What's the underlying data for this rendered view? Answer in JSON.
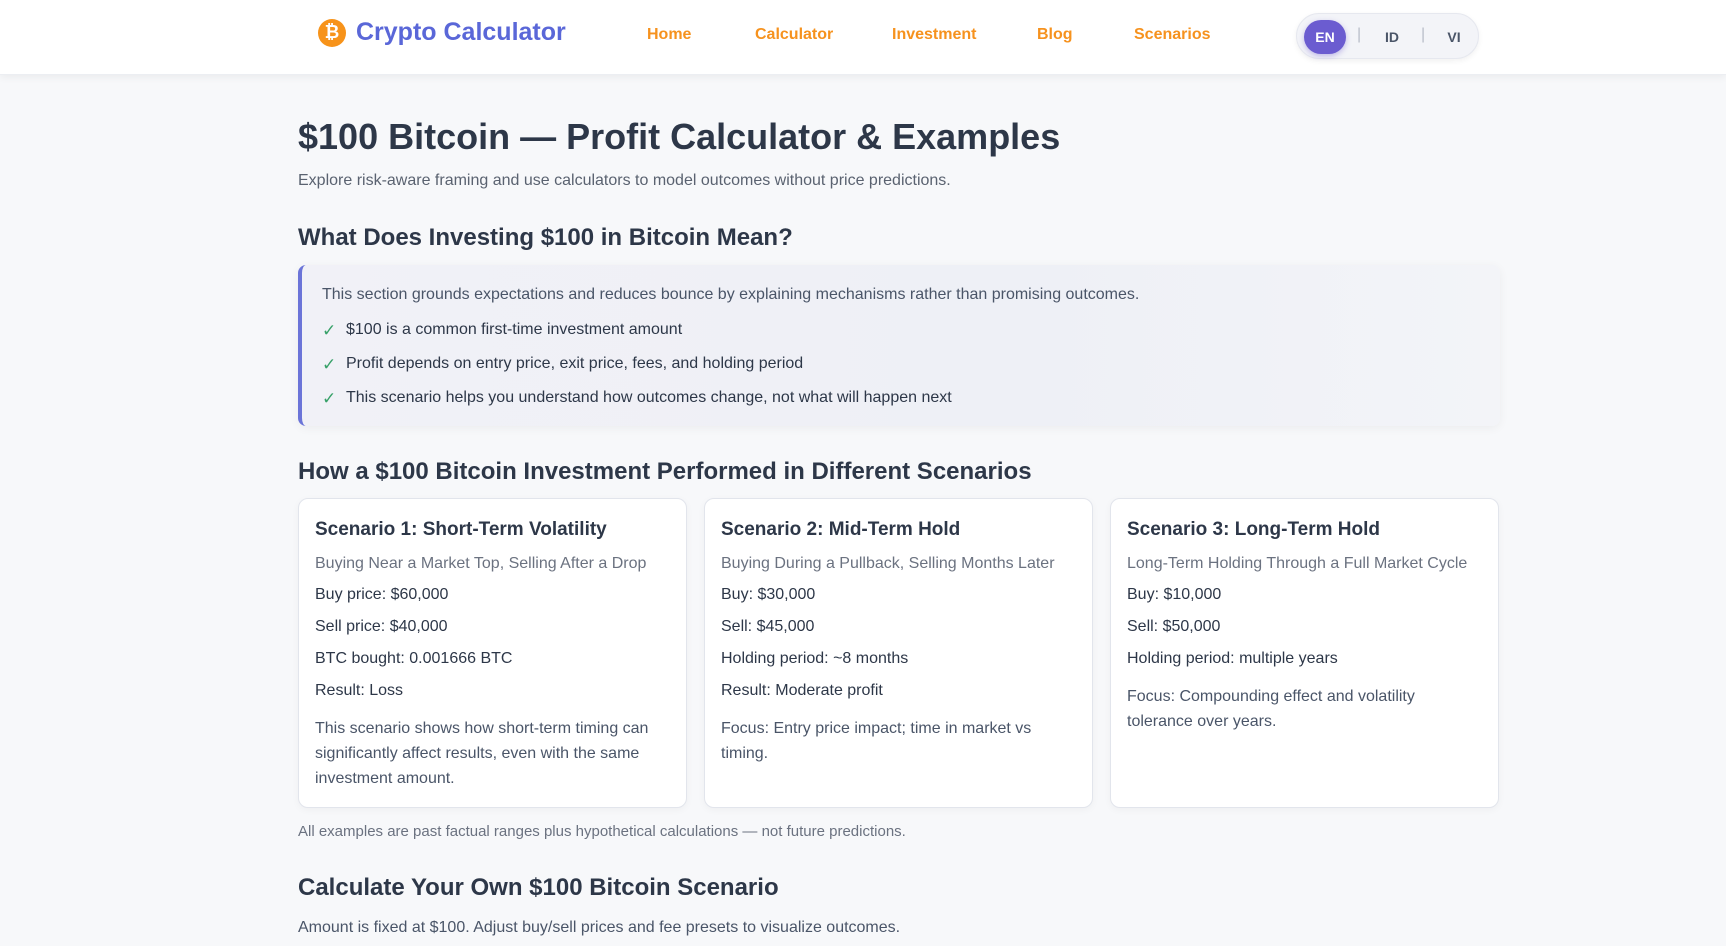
{
  "nav": {
    "brand_icon": "bitcoin-icon",
    "brand_icon_glyph": "₿",
    "brand": "Crypto Calculator",
    "links": [
      "Home",
      "Calculator",
      "Investment",
      "Blog",
      "Scenarios"
    ],
    "languages": [
      "EN",
      "ID",
      "VI"
    ],
    "active_language": "EN",
    "separator": "|"
  },
  "colors": {
    "brand": "#5a67d8",
    "nav_link": "#f6921e",
    "bitcoin": "#f7931a",
    "active_language": "#6b5cd0",
    "check": "#38a169",
    "info_border": "#6b74d8"
  },
  "page": {
    "title": "$100 Bitcoin — Profit Calculator & Examples",
    "subtitle": "Explore risk-aware framing and use calculators to model outcomes without price predictions."
  },
  "what_section": {
    "heading": "What Does Investing $100 in Bitcoin Mean?",
    "intro": "This section grounds expectations and reduces bounce by explaining mechanisms rather than promising outcomes.",
    "check_glyph": "✓",
    "points": [
      "$100 is a common first-time investment amount",
      "Profit depends on entry price, exit price, fees, and holding period",
      "This scenario helps you understand how outcomes change, not what will happen next"
    ]
  },
  "scenarios_section": {
    "heading": "How a $100 Bitcoin Investment Performed in Different Scenarios",
    "cards": [
      {
        "title": "Scenario 1: Short-Term Volatility",
        "subtitle": "Buying Near a Market Top, Selling After a Drop",
        "facts": [
          "Buy price: $60,000",
          "Sell price: $40,000",
          "BTC bought: 0.001666 BTC",
          "Result: Loss"
        ],
        "note": "This scenario shows how short-term timing can significantly affect results, even with the same investment amount."
      },
      {
        "title": "Scenario 2: Mid-Term Hold",
        "subtitle": "Buying During a Pullback, Selling Months Later",
        "facts": [
          "Buy: $30,000",
          "Sell: $45,000",
          "Holding period: ~8 months",
          "Result: Moderate profit"
        ],
        "note": "Focus: Entry price impact; time in market vs timing."
      },
      {
        "title": "Scenario 3: Long-Term Hold",
        "subtitle": "Long-Term Holding Through a Full Market Cycle",
        "facts": [
          "Buy: $10,000",
          "Sell: $50,000",
          "Holding period: multiple years"
        ],
        "note": "Focus: Compounding effect and volatility tolerance over years."
      }
    ],
    "disclaimer": "All examples are past factual ranges plus hypothetical calculations — not future predictions."
  },
  "calculator_section": {
    "heading": "Calculate Your Own $100 Bitcoin Scenario",
    "intro": "Amount is fixed at $100. Adjust buy/sell prices and fee presets to visualize outcomes."
  }
}
